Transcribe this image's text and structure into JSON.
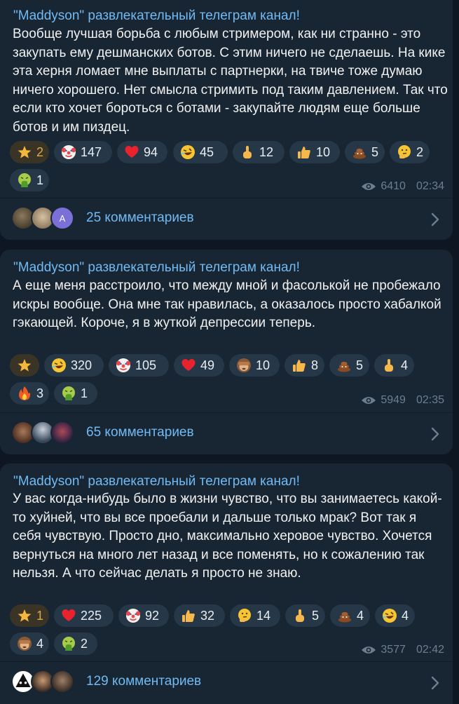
{
  "colors": {
    "background": "#0e1621",
    "card": "#182533",
    "accent": "#71baf3",
    "text": "#f1f1f1",
    "muted": "#6d7f8f",
    "pill": "#263747",
    "star_pill": "#3a3426"
  },
  "posts": [
    {
      "channel": "\"Maddyson\" развлекательный телеграм канал!",
      "text": "Вообще лучшая борьба с любым стримером, как ни странно - это закупать ему дешманских ботов. С этим ничего не сделаешь. На кике эта херня ломает мне выплаты с партнерки, на твиче тоже думаю ничего хорошего. Нет смысла стримить под таким давлением. Так что если кто хочет бороться с ботами - закупайте людям еще больше ботов и им пиздец.",
      "reactions": [
        {
          "icon": "star-icon",
          "count": "2"
        },
        {
          "icon": "clown-icon",
          "count": "147"
        },
        {
          "icon": "heart-icon",
          "count": "94"
        },
        {
          "icon": "rofl-icon",
          "count": "45"
        },
        {
          "icon": "middle-finger-icon",
          "count": "12"
        },
        {
          "icon": "thumbs-up-icon",
          "count": "10"
        },
        {
          "icon": "poop-icon",
          "count": "5"
        },
        {
          "icon": "thinking-icon",
          "count": "2"
        },
        {
          "icon": "vomit-icon",
          "count": "1"
        }
      ],
      "views": "6410",
      "time": "02:34",
      "comments": "25 комментариев"
    },
    {
      "channel": "\"Maddyson\" развлекательный телеграм канал!",
      "text": "А еще меня расстроило, что между мной и фасолькой не пробежало искры вообще. Она мне так нравилась, а оказалось просто хабалкой гэкающей. Короче, я в жуткой депрессии теперь.",
      "reactions": [
        {
          "icon": "star-icon",
          "count": ""
        },
        {
          "icon": "rofl-icon",
          "count": "320"
        },
        {
          "icon": "clown-icon",
          "count": "105"
        },
        {
          "icon": "heart-icon",
          "count": "49"
        },
        {
          "icon": "see-no-evil-monkey-icon",
          "count": "10"
        },
        {
          "icon": "thumbs-up-icon",
          "count": "8"
        },
        {
          "icon": "poop-icon",
          "count": "5"
        },
        {
          "icon": "middle-finger-icon",
          "count": "4"
        },
        {
          "icon": "fire-icon",
          "count": "3"
        },
        {
          "icon": "vomit-icon",
          "count": "1"
        }
      ],
      "views": "5949",
      "time": "02:35",
      "comments": "65 комментариев"
    },
    {
      "channel": "\"Maddyson\" развлекательный телеграм канал!",
      "text": "У вас когда-нибудь было в жизни чувство, что вы занимаетесь какой-то хуйней, что вы все проебали и дальше только мрак? Вот так я себя чувствую. Просто дно, максимально херовое чувство. Хочется вернуться на много лет назад и все поменять, но к сожалению так нельзя. А что сейчас делать я просто не знаю.",
      "reactions": [
        {
          "icon": "star-icon",
          "count": "1"
        },
        {
          "icon": "heart-icon",
          "count": "225"
        },
        {
          "icon": "clown-icon",
          "count": "92"
        },
        {
          "icon": "thumbs-up-icon",
          "count": "32"
        },
        {
          "icon": "thinking-icon",
          "count": "14"
        },
        {
          "icon": "middle-finger-icon",
          "count": "5"
        },
        {
          "icon": "poop-icon",
          "count": "4"
        },
        {
          "icon": "rofl-icon",
          "count": "4"
        },
        {
          "icon": "see-no-evil-monkey-icon",
          "count": "4"
        },
        {
          "icon": "vomit-icon",
          "count": "2"
        }
      ],
      "views": "3577",
      "time": "02:42",
      "comments": "129 комментариев"
    }
  ],
  "avatar_letter": "A"
}
